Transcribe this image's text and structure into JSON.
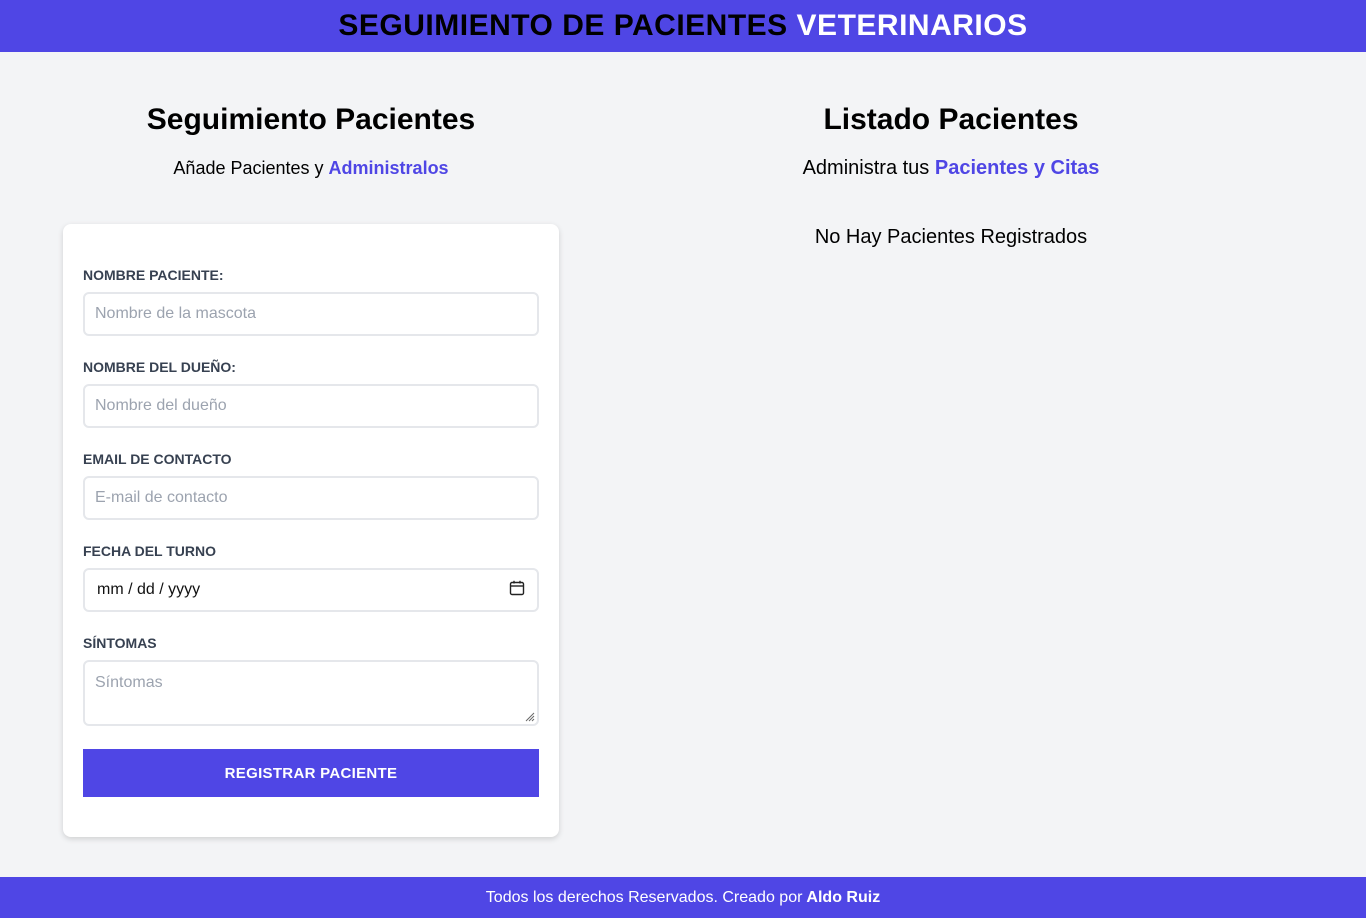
{
  "header": {
    "title_main": "Seguimiento de Pacientes",
    "title_highlight": "Veterinarios"
  },
  "form_section": {
    "title": "Seguimiento Pacientes",
    "subtitle_prefix": "Añade Pacientes y",
    "subtitle_highlight": "Administralos"
  },
  "form": {
    "pet_name": {
      "label": "Nombre Paciente:",
      "placeholder": "Nombre de la mascota",
      "value": ""
    },
    "owner_name": {
      "label": "Nombre del Dueño:",
      "placeholder": "Nombre del dueño",
      "value": ""
    },
    "email": {
      "label": "Email de contacto",
      "placeholder": "E-mail de contacto",
      "value": ""
    },
    "date": {
      "label": "Fecha del turno",
      "placeholder": "mm / dd / yyyy",
      "icon": "calendar-icon"
    },
    "symptoms": {
      "label": "Síntomas",
      "placeholder": "Síntomas",
      "value": ""
    },
    "submit_label": "Registrar Paciente"
  },
  "list_section": {
    "title": "Listado Pacientes",
    "subtitle_prefix": "Administra tus",
    "subtitle_highlight": "Pacientes y Citas",
    "empty_message": "No Hay Pacientes Registrados"
  },
  "footer": {
    "text": "Todos los derechos Reservados. Creado por",
    "author": "Aldo Ruiz"
  },
  "colors": {
    "accent": "#4f46e5",
    "background": "#f3f4f6",
    "card": "#ffffff"
  }
}
